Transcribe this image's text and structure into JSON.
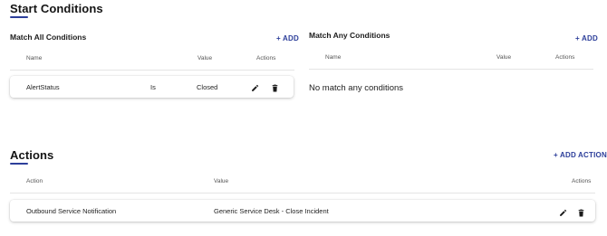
{
  "start_conditions": {
    "title": "Start Conditions",
    "match_all": {
      "title": "Match All Conditions",
      "add_label": "+ ADD",
      "columns": {
        "name": "Name",
        "value": "Value",
        "actions": "Actions"
      },
      "rows": [
        {
          "name": "AlertStatus",
          "operator": "Is",
          "value": "Closed"
        }
      ]
    },
    "match_any": {
      "title": "Match Any Conditions",
      "add_label": "+ ADD",
      "columns": {
        "name": "Name",
        "value": "Value",
        "actions": "Actions"
      },
      "empty_text": "No match any conditions"
    }
  },
  "actions": {
    "title": "Actions",
    "add_label": "+ ADD ACTION",
    "columns": {
      "action": "Action",
      "value": "Value",
      "actions": "Actions"
    },
    "rows": [
      {
        "action": "Outbound Service Notification",
        "value": "Generic Service Desk - Close Incident"
      }
    ]
  },
  "icons": {
    "edit": "pencil-icon",
    "delete": "trash-icon"
  },
  "colors": {
    "accent": "#2c3e9a",
    "text": "#1f1f1f",
    "divider": "#e4e4e4"
  }
}
